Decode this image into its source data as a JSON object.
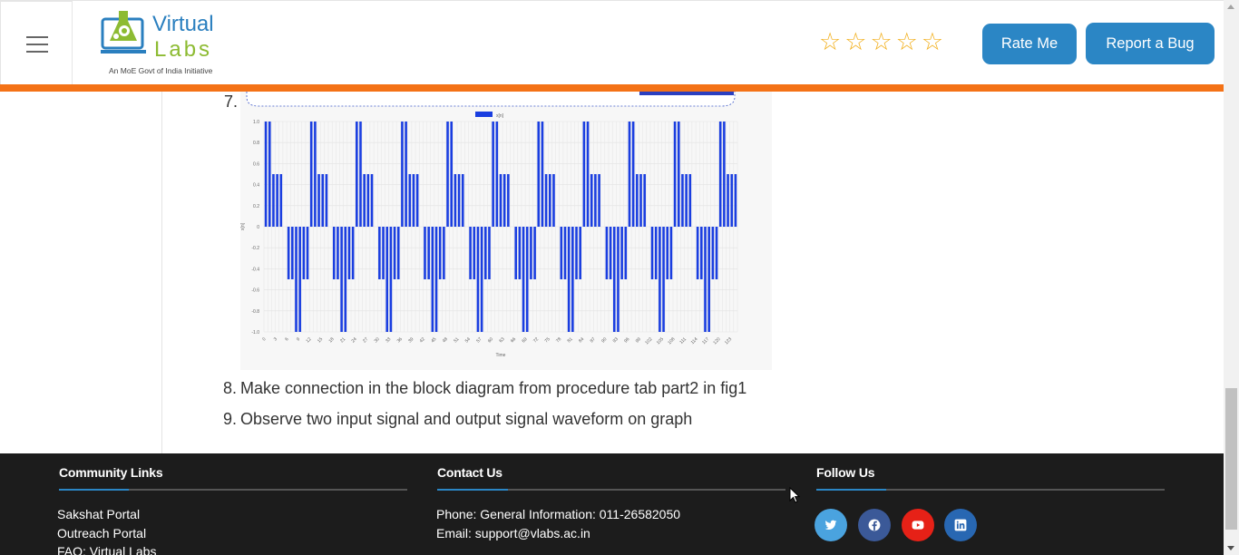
{
  "header": {
    "logo": {
      "word1": "Virtual",
      "word2": "Labs",
      "tagline": "An MoE Govt of India Initiative"
    },
    "rating_stars": 5,
    "rate_button": "Rate Me",
    "bug_button": "Report a Bug",
    "colors": {
      "accent_blue": "#2b86c5",
      "orange_bar": "#f47216",
      "star": "#f2b01e"
    }
  },
  "steps": [
    {
      "num": "7.",
      "text": ""
    },
    {
      "num": "8.",
      "text": "Make connection in the block diagram from procedure tab part2 in fig1"
    },
    {
      "num": "9.",
      "text": "Observe two input signal and output signal waveform on graph"
    }
  ],
  "chart_data": {
    "type": "bar",
    "legend": [
      "x[n]"
    ],
    "xlabel": "Time",
    "ylabel": "x[n]",
    "ylim": [
      -1.0,
      1.0
    ],
    "y_ticks": [
      "1.0",
      "0.8",
      "0.6",
      "0.4",
      "0.2",
      "0",
      "-0.2",
      "-0.4",
      "-0.6",
      "-0.8",
      "-1.0"
    ],
    "x_ticks": [
      "0",
      "3",
      "6",
      "9",
      "12",
      "15",
      "18",
      "21",
      "24",
      "27",
      "30",
      "33",
      "36",
      "39",
      "42",
      "45",
      "48",
      "51",
      "54",
      "57",
      "60",
      "63",
      "66",
      "69",
      "72",
      "75",
      "78",
      "81",
      "84",
      "87",
      "90",
      "93",
      "96",
      "99",
      "102",
      "105",
      "108",
      "111",
      "114",
      "117",
      "120",
      "123"
    ],
    "period": 12,
    "values_one_period": [
      1,
      1,
      0.5,
      0.5,
      0.5,
      0,
      -0.5,
      -0.5,
      -1,
      -1,
      -0.5,
      -0.5
    ],
    "n_points": 125,
    "bar_color": "#1a3ee0",
    "grid": true
  },
  "footer": {
    "community": {
      "heading": "Community Links",
      "links": [
        "Sakshat Portal",
        "Outreach Portal",
        "FAQ: Virtual Labs"
      ]
    },
    "contact": {
      "heading": "Contact Us",
      "phone": "Phone: General Information: 011-26582050",
      "email": "Email: support@vlabs.ac.in"
    },
    "follow": {
      "heading": "Follow Us",
      "icons": [
        "twitter-icon",
        "facebook-icon",
        "youtube-icon",
        "linkedin-icon"
      ],
      "icon_colors": [
        "#4aa3df",
        "#3b5998",
        "#e62117",
        "#2867b2"
      ]
    }
  }
}
